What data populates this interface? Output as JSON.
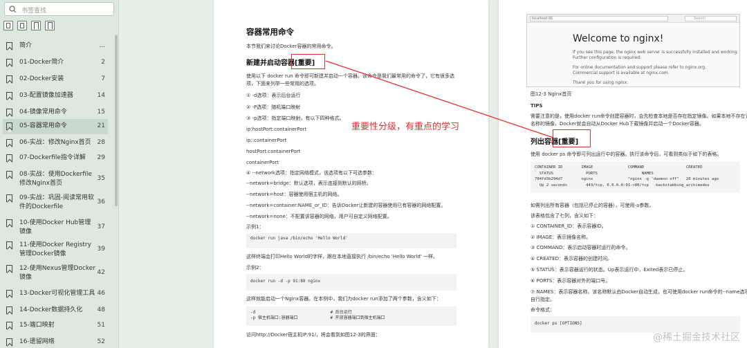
{
  "sidebar": {
    "search_placeholder": "书签查找",
    "items": [
      {
        "label": "简介",
        "page": "..."
      },
      {
        "label": "01-Docker简介",
        "page": "2"
      },
      {
        "label": "02-Docker安装",
        "page": "7"
      },
      {
        "label": "03-配置镜像加速器",
        "page": "14"
      },
      {
        "label": "04-镜像常用命令",
        "page": "15"
      },
      {
        "label": "05-容器常用命令",
        "page": "21"
      },
      {
        "label": "06-实战：修改Nginx首页",
        "page": "28"
      },
      {
        "label": "07-Dockerfile指令详解",
        "page": "29"
      },
      {
        "label": "08-实战：使用Dockerfile修改Nginx首页",
        "page": "35"
      },
      {
        "label": "09-实战：巩固-阅读常用软件的Dockerfile",
        "page": "36"
      },
      {
        "label": "10-使用Docker Hub管理镜像",
        "page": "37"
      },
      {
        "label": "11-使用Docker Registry管理Docker镜像",
        "page": "39"
      },
      {
        "label": "12-使用Nexus管理Docker镜像",
        "page": "42"
      },
      {
        "label": "13-Docker可视化管理工具",
        "page": "46"
      },
      {
        "label": "14-Docker数据持久化",
        "page": "48"
      },
      {
        "label": "15-端口映射",
        "page": "51"
      },
      {
        "label": "16-遗留网络",
        "page": "52"
      }
    ]
  },
  "left_page": {
    "title": "容器常用命令",
    "intro": "本节我们来讨论Docker容器的常用命令。",
    "section": "新建并启动容器[重要]",
    "p1a": "使用以下 docker run 命令即可新建并启动一个容器。该命令是我们最常用的命令了，它有很多选",
    "p1b": "项，下面来列举一些常用的选项。",
    "opt1": "① -d选项：表示后台运行",
    "opt2": "② -P选项：随机端口映射",
    "opt3": "③ -p选项：指定端口映射，有以下四种格式。",
    "fmt1": "ip:hostPort:containerPort",
    "fmt2": "ip::containerPort",
    "fmt3": "hostPort:containerPort",
    "fmt4": "containerPort",
    "opt4": "④ --network选项：指定网络模式，该选项有以下可选参数：",
    "net1": "--network=bridge：默认选项，表示连接到默认的网桥。",
    "net2": "--network=host：容器使用宿主机的网络。",
    "net3": "--network=container:NAME_or_ID：告诉Docker让新建的容器使用已有容器的网络配置。",
    "net4": "--network=none：不配置该容器的网络，用户可自定义网络配置。",
    "ex1_label": "示例1：",
    "ex1_code": "docker run java /bin/echo 'Hello World'",
    "ex1_text": "这样终端会打印Hello World的字样，跟在本地直接执行 /bin/echo 'Hello World' 一样。",
    "ex2_label": "示例2：",
    "ex2_code": "docker run -d -p 91:80 nginx",
    "ex2_text": "这样就能启动一个Nginx容器。在本例中，我们为docker run添加了两个参数，含义如下：",
    "ex2_detail": "-d                              # 后台运行\n-p 宿主机端口:容器端口             # 开放容器端口到宿主机端口",
    "visit": "访问http://Docker宿主机IP:91/，将会看到如图12-3的界面："
  },
  "annotation": "重要性分级，有重点的学习",
  "right_page": {
    "nginx_url": "localhost:91",
    "nginx_search": "Search",
    "nginx_title": "Welcome to nginx!",
    "nginx_l1": "If you see this page, the nginx web server is successfully installed and working.",
    "nginx_l2": "Further configuration is required.",
    "nginx_l3": "For online documentation and support please refer to nginx.org.",
    "nginx_l4": "Commercial support is available at nginx.com.",
    "nginx_l5": "Thank you for using nginx.",
    "fig_caption": "图12-3 Nginx首页",
    "tips_head": "TIPS",
    "tips_a": "需要注意的是，使用docker run命令创建容器时，会先检查本地是否存在指定镜像。如果本地不存在该",
    "tips_b": "名称的镜像，Docker就会自动从Docker Hub下载镜像并启动一个Docker容器。",
    "section": "列出容器[重要]",
    "ps_intro": "使用 docker ps 命令即可列出运行中的容器。执行该命令后，可看到类似于如下的表格。",
    "ps_table": "CONTAINER ID        IMAGE               COMMAND                  CREATED\n  STATUS              PORTS                   NAMES\n784fd3b294d7        nginx               \"nginx -g 'daemon off\"   20 minutes ago\n  Up 2 seconds        443/tcp, 0.0.0.0:91->80/tcp   backstabbing_archimedes",
    "all_text": "如需列出所有容器（包括已停止的容器），可使用-a参数。",
    "cols_text": "该表格包含了七列，含义如下：",
    "c1": "① CONTAINER_ID：表示容器ID。",
    "c2": "② IMAGE：表示镜像名称。",
    "c3": "③ COMMAND：表示启动容器时运行的命令。",
    "c4": "④ CREATED：表示容器的创建时间。",
    "c5": "⑤ STATUS：表示容器运行的状态。Up表示运行中，Exited表示已停止。",
    "c6": "⑥ PORTS：表示容器对外的端口号。",
    "c7a": "⑦ NAMES：表示容器名称。该名称默认由Docker自动生成，也可使用docker run命令的--name选项",
    "c7b": "自行指定。",
    "fmt_label": "命令格式：",
    "fmt_code": "docker ps [OPTIONS]"
  },
  "watermark": "@稀土掘金技术社区"
}
